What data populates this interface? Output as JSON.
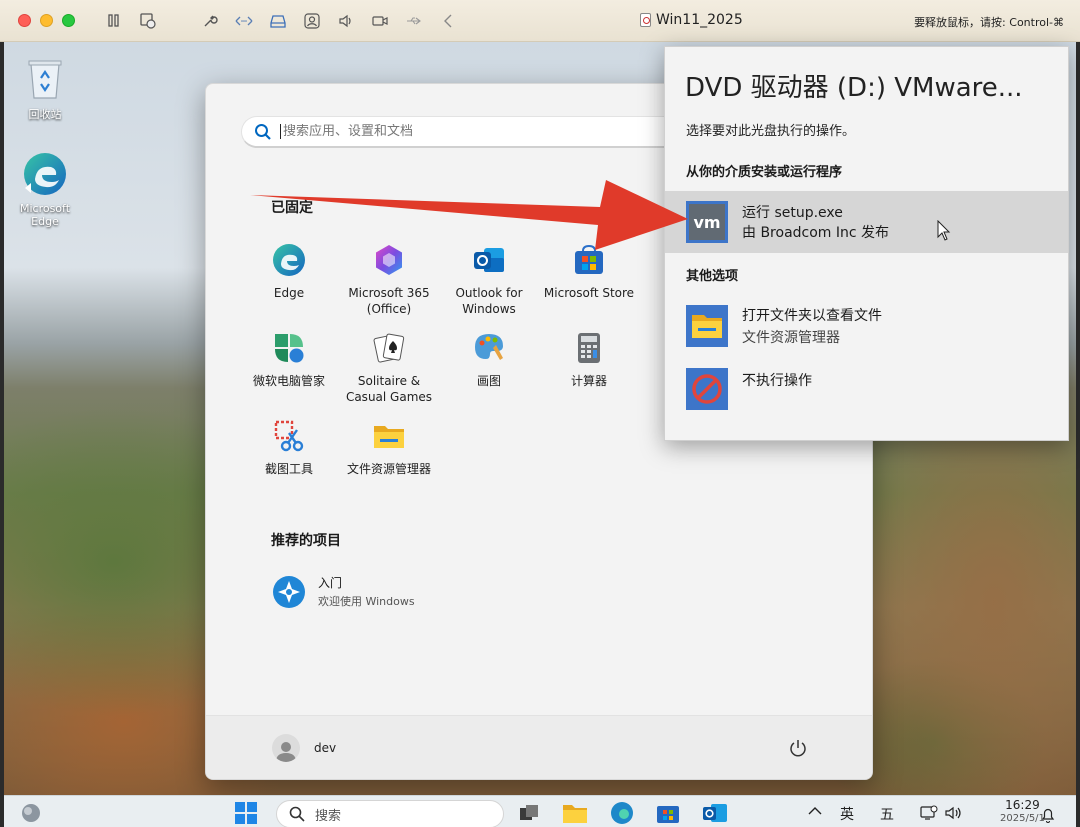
{
  "window": {
    "title": "Win11_2025",
    "release_hint": "要释放鼠标，请按: Control-⌘"
  },
  "desktop": {
    "icons": [
      {
        "label": "回收站"
      },
      {
        "label": "Microsoft Edge"
      }
    ]
  },
  "start_menu": {
    "search_placeholder": "搜索应用、设置和文档",
    "pinned_title": "已固定",
    "pinned": [
      {
        "label": "Edge",
        "icon": "edge-icon"
      },
      {
        "label": "Microsoft 365 (Office)",
        "icon": "m365-icon"
      },
      {
        "label": "Outlook for Windows",
        "icon": "outlook-icon"
      },
      {
        "label": "Microsoft Store",
        "icon": "store-icon"
      },
      {
        "label": "微软电脑管家",
        "icon": "pc-manager-icon"
      },
      {
        "label": "Solitaire & Casual Games",
        "icon": "solitaire-icon"
      },
      {
        "label": "画图",
        "icon": "paint-icon"
      },
      {
        "label": "计算器",
        "icon": "calculator-icon"
      },
      {
        "label": "截图工具",
        "icon": "snipping-tool-icon"
      },
      {
        "label": "文件资源管理器",
        "icon": "file-explorer-icon"
      }
    ],
    "recommended_title": "推荐的项目",
    "recommended": [
      {
        "title": "入门",
        "subtitle": "欢迎使用 Windows"
      }
    ],
    "user": "dev"
  },
  "autoplay": {
    "title": "DVD 驱动器 (D:) VMware...",
    "subtitle": "选择要对此光盘执行的操作。",
    "section1": "从你的介质安装或运行程序",
    "run_title": "运行 setup.exe",
    "run_subtitle": "由 Broadcom Inc 发布",
    "section2": "其他选项",
    "open_title": "打开文件夹以查看文件",
    "open_subtitle": "文件资源管理器",
    "none_title": "不执行操作"
  },
  "taskbar": {
    "search_placeholder": "搜索",
    "ime": "英",
    "ime2": "五",
    "time": "16:29",
    "date": "2025/5/1"
  },
  "colors": {
    "accent": "#0067c0",
    "arrow": "#e03a2a",
    "highlight": "#d6d6d6"
  }
}
